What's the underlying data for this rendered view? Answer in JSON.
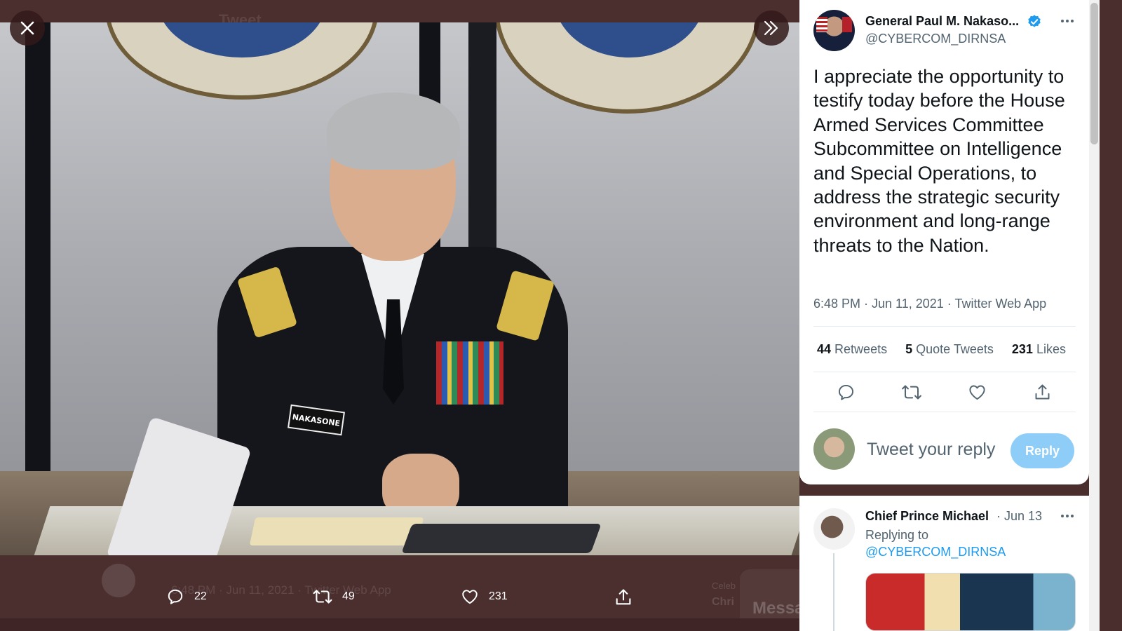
{
  "media_viewer": {
    "ghost_header_title": "Tweet",
    "photo_nameplate": "NAKASONE",
    "ghost_footer_line": "6:48 PM · Jun 11, 2021 · Twitter Web App",
    "ghost_celeb": "Celeb",
    "ghost_chri": "Chri",
    "ghost_messages": "Messa",
    "actions": {
      "reply_count": "22",
      "retweet_count": "49",
      "like_count": "231"
    }
  },
  "tweet": {
    "author_name": "General Paul M. Nakaso...",
    "author_handle": "@CYBERCOM_DIRNSA",
    "text": "I appreciate the opportunity to testify today before the House Armed Services Committee Subcommittee on Intelligence and Special Operations, to address the strategic security environment and long-range threats to the Nation.",
    "meta": "6:48 PM · Jun 11, 2021 · Twitter Web App",
    "stats": {
      "retweets_count": "44",
      "retweets_label": "Retweets",
      "quote_count": "5",
      "quote_label": "Quote Tweets",
      "likes_count": "231",
      "likes_label": "Likes"
    }
  },
  "reply_box": {
    "placeholder": "Tweet your reply",
    "button_label": "Reply"
  },
  "reply_thread": {
    "author_name": "Chief Prince Michael",
    "date": "· Jun 13",
    "replying_to_label": "Replying to",
    "mention": "@CYBERCOM_DIRNSA"
  },
  "colors": {
    "overlay_bg": "#4b2e2e",
    "accent_blue": "#1d9bf0",
    "reply_button_disabled": "#8ecdf8",
    "secondary_text": "#536471"
  },
  "icons": [
    "close-icon",
    "expand-icon",
    "verified-icon",
    "more-icon",
    "reply-icon",
    "retweet-icon",
    "like-icon",
    "share-icon"
  ]
}
